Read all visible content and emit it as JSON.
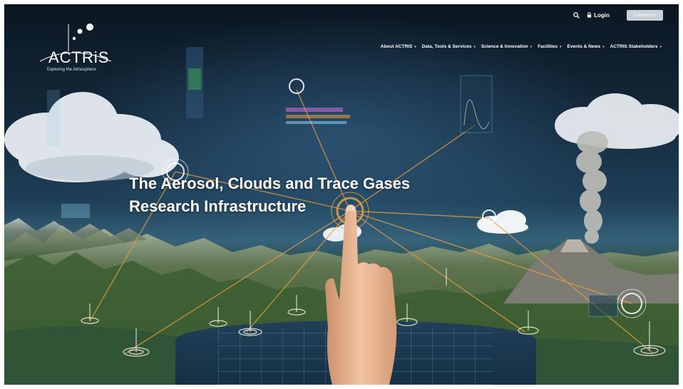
{
  "header": {
    "logo": {
      "name": "ACTRiS",
      "tagline": "Exploring the Atmosphere"
    },
    "utility": {
      "search_icon": "search-icon",
      "login_label": "Login",
      "contact_label": "Contact us"
    },
    "nav": [
      {
        "label": "About ACTRIS",
        "has_dropdown": true
      },
      {
        "label": "Data, Tools & Services",
        "has_dropdown": true
      },
      {
        "label": "Science & Innovation",
        "has_dropdown": true
      },
      {
        "label": "Facilities",
        "has_dropdown": true
      },
      {
        "label": "Events & News",
        "has_dropdown": true
      },
      {
        "label": "ACTRIS Stakeholders",
        "has_dropdown": true
      }
    ]
  },
  "hero": {
    "title_line1": "The Aerosol, Clouds and Trace Gases",
    "title_line2": "Research Infrastructure"
  },
  "colors": {
    "sky_dark": "#0b1722",
    "accent_orange": "#e8a040",
    "accent_cyan": "#8ad4f0",
    "button_gray": "#c9d1d8"
  }
}
